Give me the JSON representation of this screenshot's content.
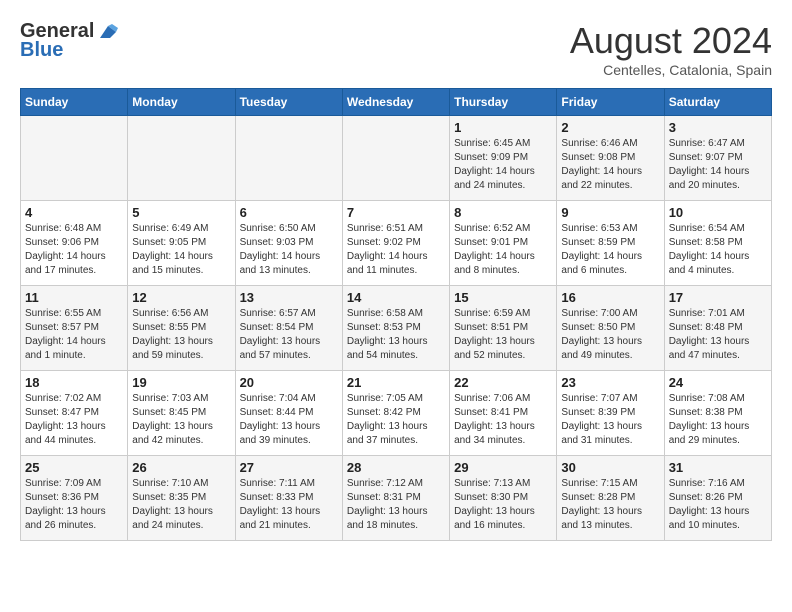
{
  "logo": {
    "line1": "General",
    "line2": "Blue"
  },
  "title": "August 2024",
  "subtitle": "Centelles, Catalonia, Spain",
  "days_of_week": [
    "Sunday",
    "Monday",
    "Tuesday",
    "Wednesday",
    "Thursday",
    "Friday",
    "Saturday"
  ],
  "weeks": [
    [
      {
        "day": "",
        "info": ""
      },
      {
        "day": "",
        "info": ""
      },
      {
        "day": "",
        "info": ""
      },
      {
        "day": "",
        "info": ""
      },
      {
        "day": "1",
        "info": "Sunrise: 6:45 AM\nSunset: 9:09 PM\nDaylight: 14 hours\nand 24 minutes."
      },
      {
        "day": "2",
        "info": "Sunrise: 6:46 AM\nSunset: 9:08 PM\nDaylight: 14 hours\nand 22 minutes."
      },
      {
        "day": "3",
        "info": "Sunrise: 6:47 AM\nSunset: 9:07 PM\nDaylight: 14 hours\nand 20 minutes."
      }
    ],
    [
      {
        "day": "4",
        "info": "Sunrise: 6:48 AM\nSunset: 9:06 PM\nDaylight: 14 hours\nand 17 minutes."
      },
      {
        "day": "5",
        "info": "Sunrise: 6:49 AM\nSunset: 9:05 PM\nDaylight: 14 hours\nand 15 minutes."
      },
      {
        "day": "6",
        "info": "Sunrise: 6:50 AM\nSunset: 9:03 PM\nDaylight: 14 hours\nand 13 minutes."
      },
      {
        "day": "7",
        "info": "Sunrise: 6:51 AM\nSunset: 9:02 PM\nDaylight: 14 hours\nand 11 minutes."
      },
      {
        "day": "8",
        "info": "Sunrise: 6:52 AM\nSunset: 9:01 PM\nDaylight: 14 hours\nand 8 minutes."
      },
      {
        "day": "9",
        "info": "Sunrise: 6:53 AM\nSunset: 8:59 PM\nDaylight: 14 hours\nand 6 minutes."
      },
      {
        "day": "10",
        "info": "Sunrise: 6:54 AM\nSunset: 8:58 PM\nDaylight: 14 hours\nand 4 minutes."
      }
    ],
    [
      {
        "day": "11",
        "info": "Sunrise: 6:55 AM\nSunset: 8:57 PM\nDaylight: 14 hours\nand 1 minute."
      },
      {
        "day": "12",
        "info": "Sunrise: 6:56 AM\nSunset: 8:55 PM\nDaylight: 13 hours\nand 59 minutes."
      },
      {
        "day": "13",
        "info": "Sunrise: 6:57 AM\nSunset: 8:54 PM\nDaylight: 13 hours\nand 57 minutes."
      },
      {
        "day": "14",
        "info": "Sunrise: 6:58 AM\nSunset: 8:53 PM\nDaylight: 13 hours\nand 54 minutes."
      },
      {
        "day": "15",
        "info": "Sunrise: 6:59 AM\nSunset: 8:51 PM\nDaylight: 13 hours\nand 52 minutes."
      },
      {
        "day": "16",
        "info": "Sunrise: 7:00 AM\nSunset: 8:50 PM\nDaylight: 13 hours\nand 49 minutes."
      },
      {
        "day": "17",
        "info": "Sunrise: 7:01 AM\nSunset: 8:48 PM\nDaylight: 13 hours\nand 47 minutes."
      }
    ],
    [
      {
        "day": "18",
        "info": "Sunrise: 7:02 AM\nSunset: 8:47 PM\nDaylight: 13 hours\nand 44 minutes."
      },
      {
        "day": "19",
        "info": "Sunrise: 7:03 AM\nSunset: 8:45 PM\nDaylight: 13 hours\nand 42 minutes."
      },
      {
        "day": "20",
        "info": "Sunrise: 7:04 AM\nSunset: 8:44 PM\nDaylight: 13 hours\nand 39 minutes."
      },
      {
        "day": "21",
        "info": "Sunrise: 7:05 AM\nSunset: 8:42 PM\nDaylight: 13 hours\nand 37 minutes."
      },
      {
        "day": "22",
        "info": "Sunrise: 7:06 AM\nSunset: 8:41 PM\nDaylight: 13 hours\nand 34 minutes."
      },
      {
        "day": "23",
        "info": "Sunrise: 7:07 AM\nSunset: 8:39 PM\nDaylight: 13 hours\nand 31 minutes."
      },
      {
        "day": "24",
        "info": "Sunrise: 7:08 AM\nSunset: 8:38 PM\nDaylight: 13 hours\nand 29 minutes."
      }
    ],
    [
      {
        "day": "25",
        "info": "Sunrise: 7:09 AM\nSunset: 8:36 PM\nDaylight: 13 hours\nand 26 minutes."
      },
      {
        "day": "26",
        "info": "Sunrise: 7:10 AM\nSunset: 8:35 PM\nDaylight: 13 hours\nand 24 minutes."
      },
      {
        "day": "27",
        "info": "Sunrise: 7:11 AM\nSunset: 8:33 PM\nDaylight: 13 hours\nand 21 minutes."
      },
      {
        "day": "28",
        "info": "Sunrise: 7:12 AM\nSunset: 8:31 PM\nDaylight: 13 hours\nand 18 minutes."
      },
      {
        "day": "29",
        "info": "Sunrise: 7:13 AM\nSunset: 8:30 PM\nDaylight: 13 hours\nand 16 minutes."
      },
      {
        "day": "30",
        "info": "Sunrise: 7:15 AM\nSunset: 8:28 PM\nDaylight: 13 hours\nand 13 minutes."
      },
      {
        "day": "31",
        "info": "Sunrise: 7:16 AM\nSunset: 8:26 PM\nDaylight: 13 hours\nand 10 minutes."
      }
    ]
  ]
}
